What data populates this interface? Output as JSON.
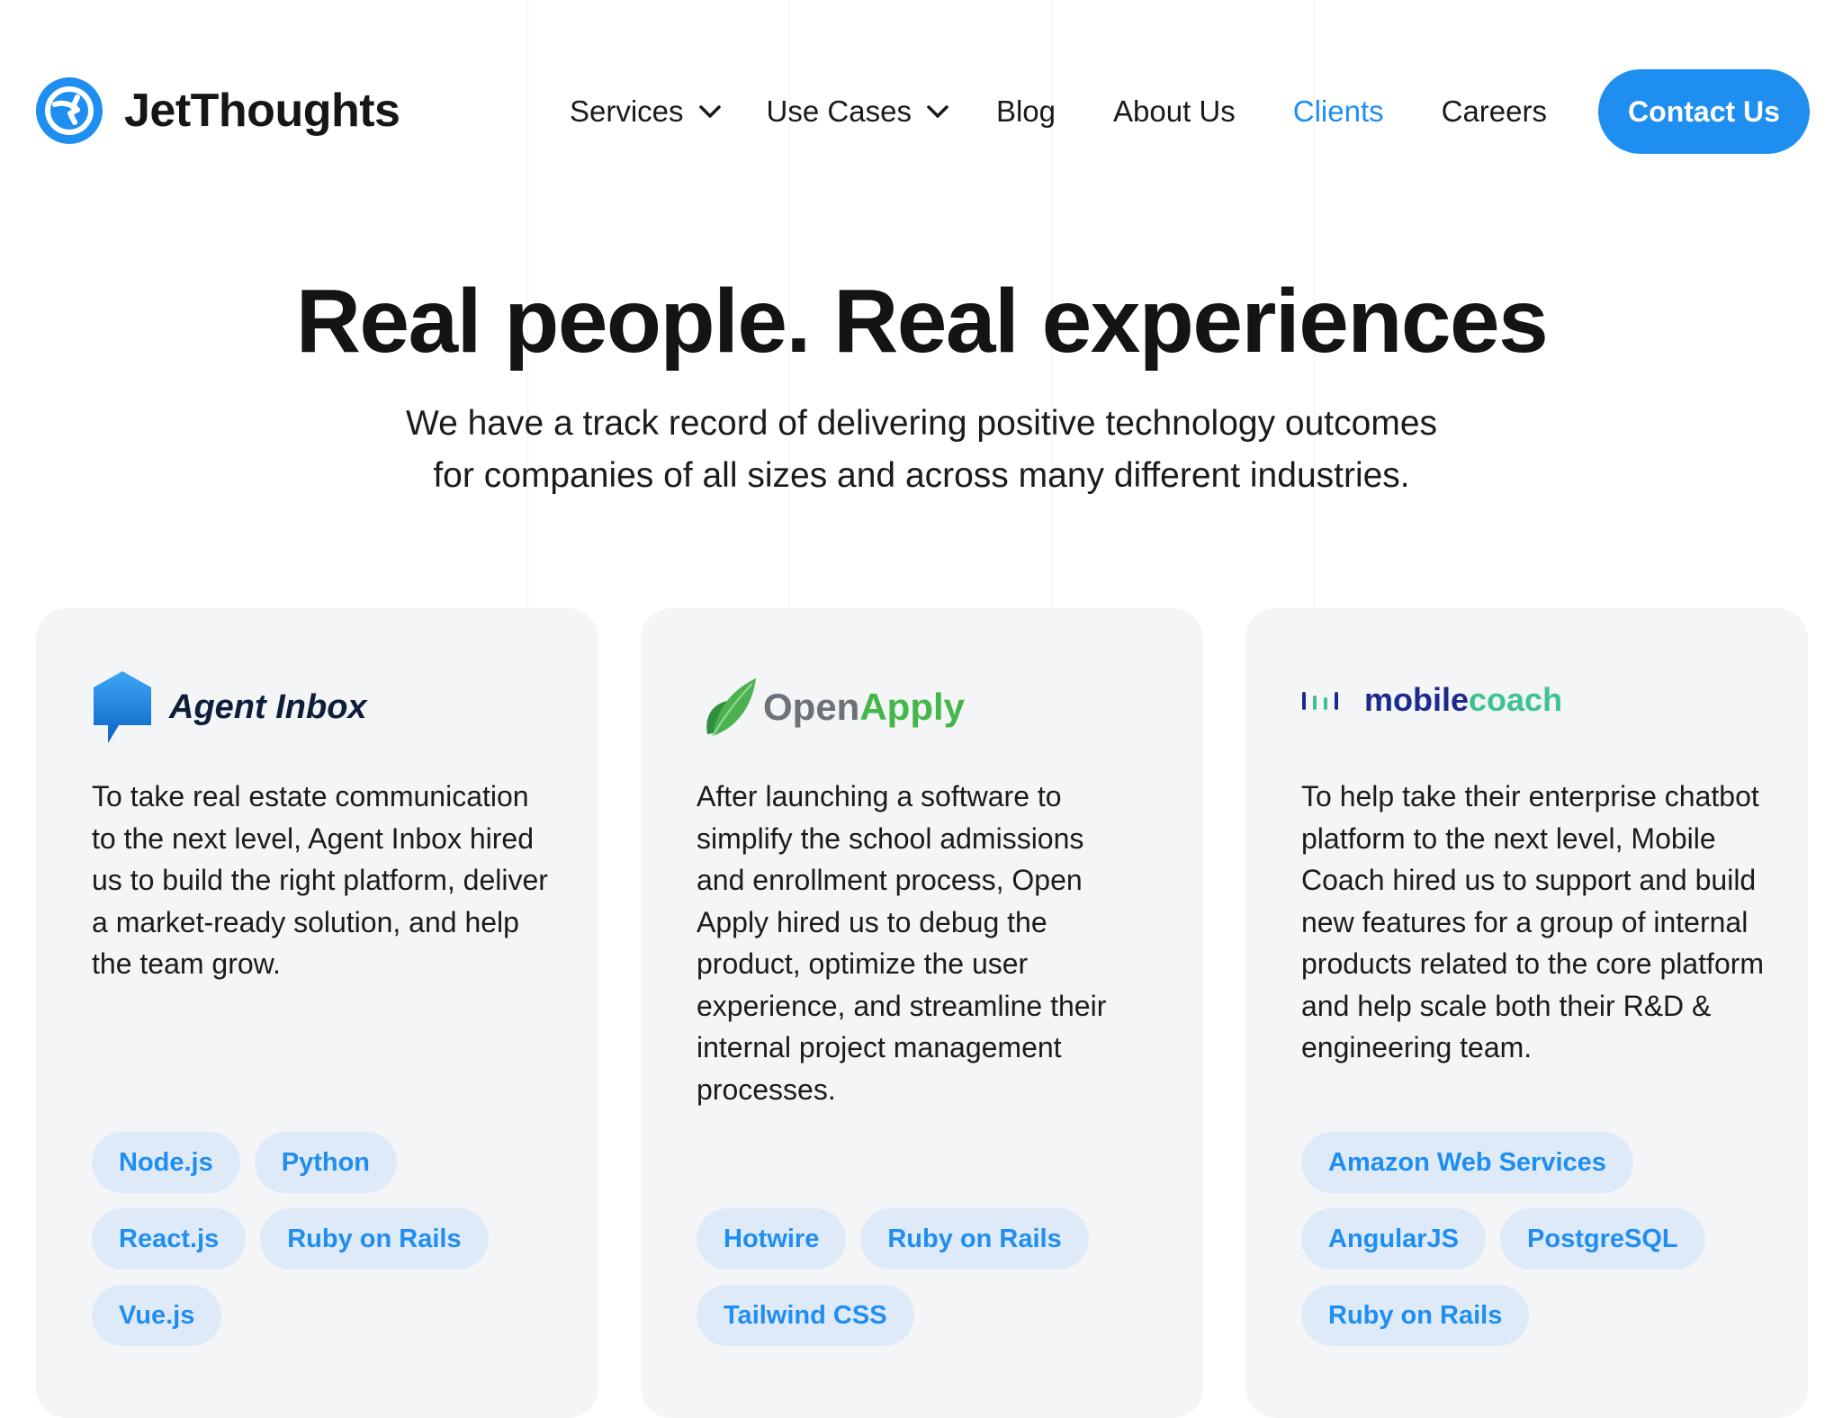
{
  "brand": {
    "name": "JetThoughts",
    "logo_icon": "jetthoughts-globe-icon",
    "accent": "#1f8ef1"
  },
  "nav": {
    "items": [
      {
        "label": "Services",
        "has_dropdown": true
      },
      {
        "label": "Use Cases",
        "has_dropdown": true
      },
      {
        "label": "Blog"
      },
      {
        "label": "About Us"
      },
      {
        "label": "Clients",
        "active": true
      },
      {
        "label": "Careers"
      }
    ],
    "cta": "Contact Us"
  },
  "hero": {
    "title": "Real people. Real experiences",
    "subtitle_line1": "We have a track record of delivering positive technology outcomes",
    "subtitle_line2": "for companies of all sizes and across many different industries."
  },
  "clients": [
    {
      "logo_name": "Agent Inbox",
      "logo_icon": "agent-inbox-logo-icon",
      "description": "To take real estate communication to the next level, Agent Inbox hired us to build the right platform, deliver a market-ready solution, and help the team grow.",
      "tags": [
        "Node.js",
        "Python",
        "React.js",
        "Ruby on Rails",
        "Vue.js"
      ]
    },
    {
      "logo_name_part1": "Open",
      "logo_name_part2": "Apply",
      "logo_icon": "openapply-leaf-icon",
      "description": "After launching a software to simplify the school admissions and enrollment process, Open Apply hired us to debug the product, optimize the user experience, and streamline their internal project management processes.",
      "tags": [
        "Hotwire",
        "Ruby on Rails",
        "Tailwind CSS"
      ]
    },
    {
      "logo_name_part1": "mobile",
      "logo_name_part2": "coach",
      "logo_icon": "mobilecoach-bars-icon",
      "description": "To help take their enterprise chatbot platform to the next level, Mobile Coach hired us to support and build new features for a group of internal products related to the core platform and help scale both their R&D & engineering team.",
      "tags": [
        "Amazon Web Services",
        "AngularJS",
        "PostgreSQL",
        "Ruby on Rails"
      ]
    }
  ]
}
